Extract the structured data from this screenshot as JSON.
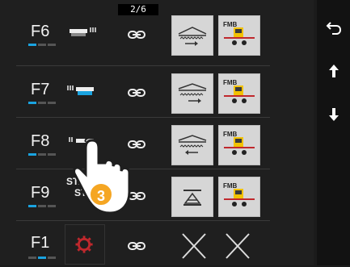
{
  "page_indicator": "2/6",
  "rows": [
    {
      "fkey": "F6",
      "dots": [
        true,
        false,
        false
      ]
    },
    {
      "fkey": "F7",
      "dots": [
        true,
        false,
        false
      ]
    },
    {
      "fkey": "F8",
      "dots": [
        true,
        false,
        false
      ]
    },
    {
      "fkey": "F9",
      "dots": [
        true,
        false,
        false
      ],
      "func_text": [
        "START",
        "STOP"
      ]
    },
    {
      "fkey": "F1",
      "dots": [
        false,
        true,
        false
      ]
    }
  ],
  "tap_badge": "3",
  "colors": {
    "accent": "#1aa3e0",
    "badge": "#f5a623",
    "gear": "#c0282d"
  },
  "icons": {
    "side": [
      "return-icon",
      "arrow-up-icon",
      "arrow-down-icon"
    ]
  }
}
